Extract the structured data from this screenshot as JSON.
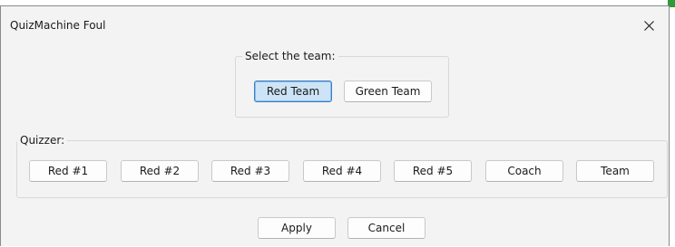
{
  "window": {
    "title": "QuizMachine Foul"
  },
  "team_group": {
    "label": "Select the team:",
    "buttons": [
      "Red Team",
      "Green Team"
    ],
    "selected": "Red Team"
  },
  "quizzer_group": {
    "label": "Quizzer:",
    "buttons": [
      "Red #1",
      "Red #2",
      "Red #3",
      "Red #4",
      "Red #5",
      "Coach",
      "Team"
    ]
  },
  "actions": {
    "apply_label": "Apply",
    "cancel_label": "Cancel"
  },
  "colors": {
    "selected_fill": "#cde4f7",
    "selected_border": "#3c7fc6",
    "window_bg": "#f3f3f3",
    "edge_accent": "#2e9a3a"
  },
  "icons": {
    "close": "close-icon"
  }
}
